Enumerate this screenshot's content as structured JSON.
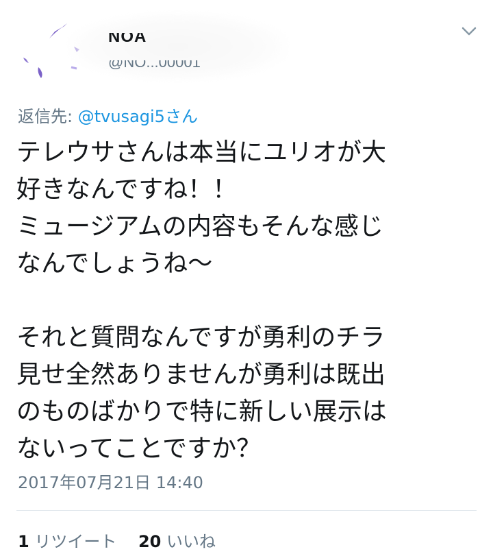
{
  "user": {
    "name": "NOA",
    "handle": "@NO...00001"
  },
  "reply_to": {
    "label": "返信先:",
    "mention": "@tvusagi5さん"
  },
  "tweet": {
    "text": "テレウサさんは本当にユリオが大\n好きなんですね！！\nミュージアムの内容もそんな感じ\nなんでしょうね〜\n\nそれと質問なんですが勇利のチラ\n見せ全然ありませんが勇利は既出\nのものばかりで特に新しい展示は\nないってことですか？",
    "timestamp": "2017年07月21日 14:40"
  },
  "stats": {
    "retweets_count": "1",
    "retweets_label": "リツイート",
    "likes_count": "20",
    "likes_label": "いいね"
  },
  "icons": [
    "avatar",
    "chevron-down-icon"
  ],
  "colors": {
    "link": "#1b95e0",
    "secondary_text": "#657786",
    "primary_text": "#14171a",
    "avatar_scribble": "#7b62c8"
  }
}
